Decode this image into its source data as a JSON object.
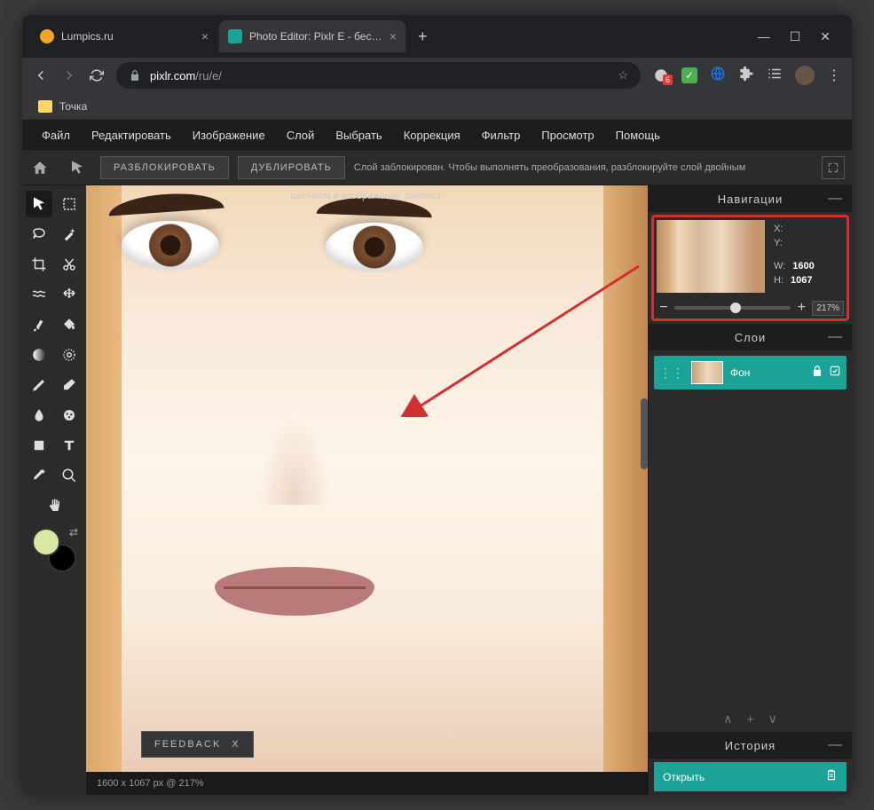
{
  "browser": {
    "tabs": [
      {
        "label": "Lumpics.ru",
        "favicon": "#f5a623"
      },
      {
        "label": "Photo Editor: Pixlr E - бесплатн",
        "favicon": "#1ba398"
      }
    ],
    "url_host": "pixlr.com",
    "url_path": "/ru/e/",
    "bookmark": "Точка",
    "ext_badge": "6"
  },
  "menu": [
    "Файл",
    "Редактировать",
    "Изображение",
    "Слой",
    "Выбрать",
    "Коррекция",
    "Фильтр",
    "Просмотр",
    "Помощь"
  ],
  "subbar": {
    "unlock": "РАЗБЛОКИРОВАТЬ",
    "duplicate": "ДУБЛИРОВАТЬ",
    "msg1": "Слой заблокирован. Чтобы выполнять преобразования, разблокируйте слой двойным",
    "msg2": "щелчком в изображение замочка."
  },
  "feedback": {
    "label": "FEEDBACK",
    "close": "X"
  },
  "status": "1600 x 1067 px @ 217%",
  "panels": {
    "nav_title": "Навигации",
    "layers_title": "Слои",
    "history_title": "История",
    "x_label": "X:",
    "y_label": "Y:",
    "w_label": "W:",
    "w_val": "1600",
    "h_label": "H:",
    "h_val": "1067",
    "zoom": "217%"
  },
  "layer": {
    "name": "Фон"
  },
  "history": {
    "open": "Открыть"
  }
}
